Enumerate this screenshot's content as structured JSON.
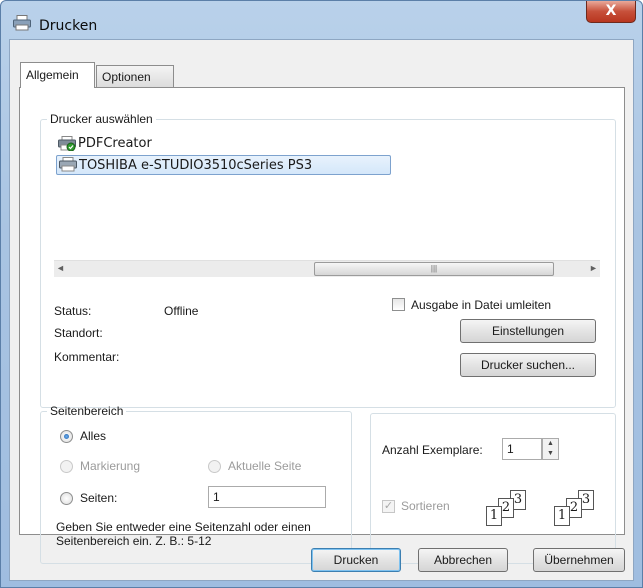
{
  "window": {
    "title": "Drucken",
    "close_symbol": "X"
  },
  "tabs": [
    {
      "label": "Allgemein",
      "active": true
    },
    {
      "label": "Optionen",
      "active": false
    }
  ],
  "printer_group": {
    "legend": "Drucker auswählen",
    "printers": [
      {
        "name": "PDFCreator",
        "icon": "printer-icon-default",
        "selected": false
      },
      {
        "name": "TOSHIBA e-STUDIO3510cSeries PS3",
        "icon": "printer-icon",
        "selected": true
      }
    ],
    "scroll_left": "◄",
    "scroll_right": "►",
    "scroll_grip": "|||",
    "status_label": "Status:",
    "status_value": "Offline",
    "location_label": "Standort:",
    "location_value": "",
    "comment_label": "Kommentar:",
    "comment_value": "",
    "print_to_file_label": "Ausgabe in Datei umleiten",
    "print_to_file_checked": false,
    "settings_button": "Einstellungen",
    "find_printer_button": "Drucker suchen..."
  },
  "page_range": {
    "legend": "Seitenbereich",
    "all_label": "Alles",
    "selection_label": "Markierung",
    "current_page_label": "Aktuelle Seite",
    "pages_label": "Seiten:",
    "pages_value": "1",
    "hint": "Geben Sie entweder eine Seitenzahl oder einen Seitenbereich ein. Z. B.: 5-12"
  },
  "copies": {
    "copies_label": "Anzahl Exemplare:",
    "copies_value": "1",
    "spin_up": "▲",
    "spin_down": "▼",
    "collate_label": "Sortieren",
    "collate_check": "✓",
    "collate_checked": true,
    "collate_pages": [
      "1",
      "2",
      "3"
    ]
  },
  "buttons": {
    "print": "Drucken",
    "cancel": "Abbrechen",
    "apply": "Übernehmen"
  }
}
